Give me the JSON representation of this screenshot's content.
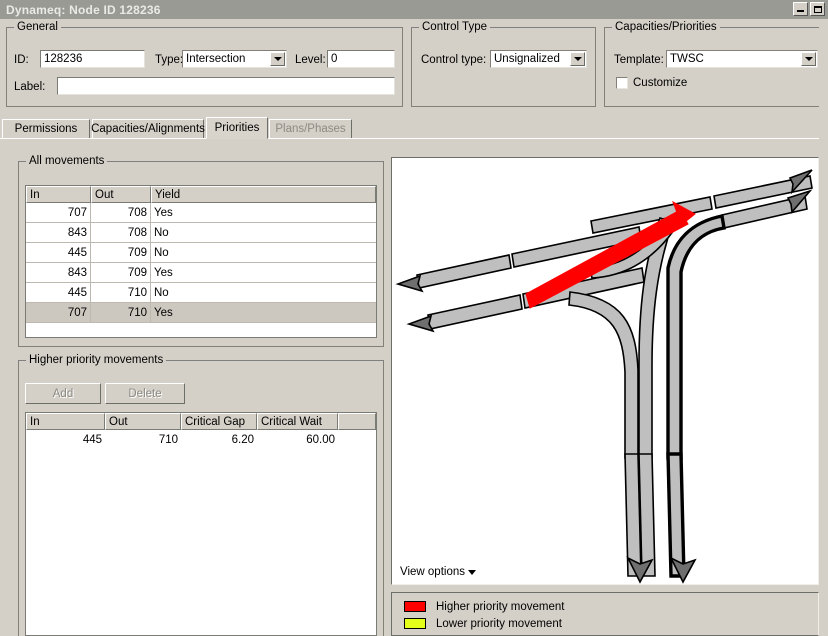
{
  "window": {
    "title": "Dynameq: Node ID 128236",
    "buttons": {
      "minimize": "minimize-icon",
      "maximize": "maximize-icon"
    }
  },
  "general": {
    "legend": "General",
    "id_label": "ID:",
    "id_value": "128236",
    "type_label": "Type:",
    "type_value": "Intersection",
    "level_label": "Level:",
    "level_value": "0",
    "label_label": "Label:",
    "label_value": "",
    "label_placeholder": ""
  },
  "control_type": {
    "legend": "Control Type",
    "control_label": "Control type:",
    "control_value": "Unsignalized"
  },
  "capacities": {
    "legend": "Capacities/Priorities",
    "template_label": "Template:",
    "template_value": "TWSC",
    "customize_label": "Customize",
    "customize_checked": false
  },
  "tabs": [
    {
      "label": "Permissions",
      "active": false,
      "disabled": false
    },
    {
      "label": "Capacities/Alignments",
      "active": false,
      "disabled": false
    },
    {
      "label": "Priorities",
      "active": true,
      "disabled": false
    },
    {
      "label": "Plans/Phases",
      "active": false,
      "disabled": true
    }
  ],
  "all_movements": {
    "legend": "All movements",
    "columns": [
      "In",
      "Out",
      "Yield"
    ],
    "rows": [
      {
        "in": "707",
        "out": "708",
        "yield": "Yes",
        "selected": false
      },
      {
        "in": "843",
        "out": "708",
        "yield": "No",
        "selected": false
      },
      {
        "in": "445",
        "out": "709",
        "yield": "No",
        "selected": false
      },
      {
        "in": "843",
        "out": "709",
        "yield": "Yes",
        "selected": false
      },
      {
        "in": "445",
        "out": "710",
        "yield": "No",
        "selected": false
      },
      {
        "in": "707",
        "out": "710",
        "yield": "Yes",
        "selected": true
      }
    ]
  },
  "higher_priority": {
    "legend": "Higher priority movements",
    "add_label": "Add",
    "delete_label": "Delete",
    "add_enabled": false,
    "delete_enabled": false,
    "columns": [
      "In",
      "Out",
      "Critical Gap",
      "Critical Wait",
      ""
    ],
    "rows": [
      {
        "in": "445",
        "out": "710",
        "critical_gap": "6.20",
        "critical_wait": "60.00"
      }
    ]
  },
  "diagram": {
    "view_options_label": "View options",
    "view_options_caret": "chevron-down-icon",
    "colors": {
      "link_fill": "#bfbfbf",
      "link_stroke": "#000000",
      "arrow_fill": "#808080",
      "highlight": "#ff0000",
      "background": "#ffffff"
    }
  },
  "legend": {
    "items": [
      {
        "color": "#ff0000",
        "label": "Higher priority movement"
      },
      {
        "color": "#e4ff1a",
        "label": "Lower priority movement"
      }
    ]
  }
}
